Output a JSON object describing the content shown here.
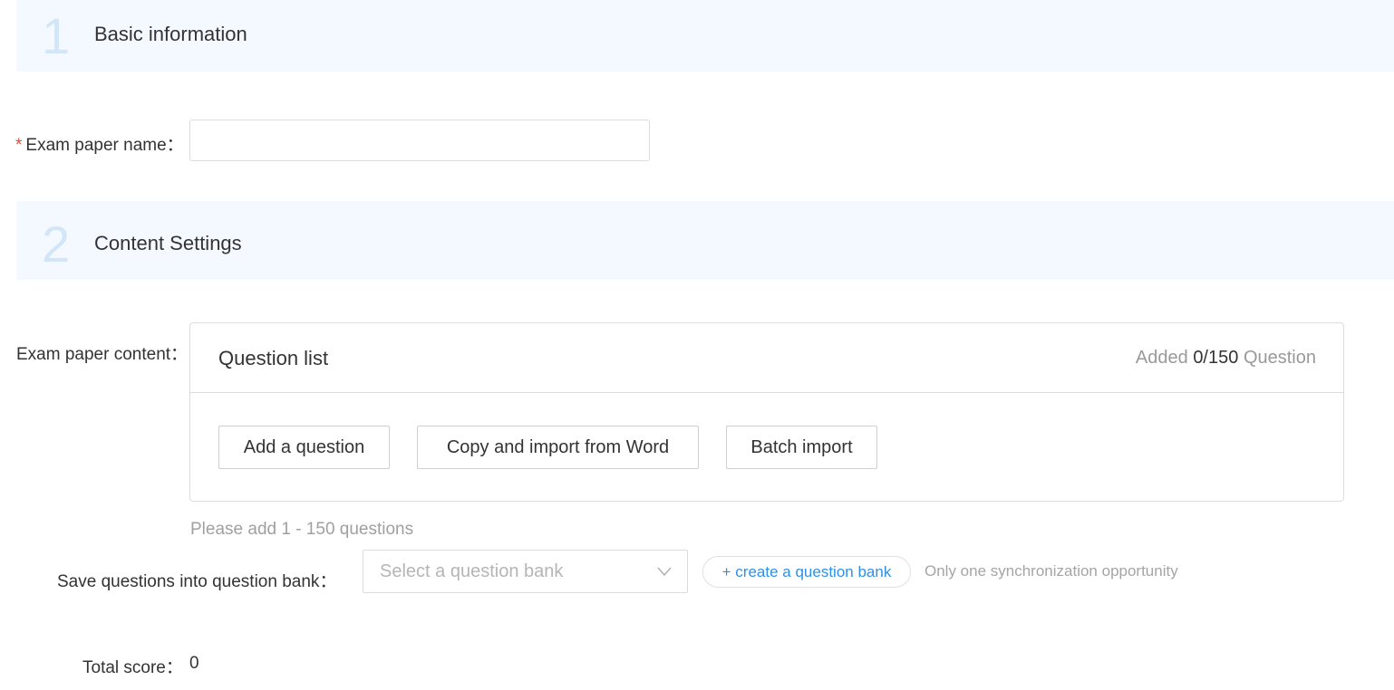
{
  "sections": [
    {
      "number": "1",
      "title": "Basic information"
    },
    {
      "number": "2",
      "title": "Content Settings"
    }
  ],
  "exam_name": {
    "required_mark": "*",
    "label": "Exam paper name",
    "colon": "：",
    "value": "",
    "placeholder": ""
  },
  "content": {
    "label": "Exam paper content",
    "colon": "：",
    "question_list": {
      "title": "Question list",
      "added_prefix": "Added",
      "added_count": "0/150",
      "added_suffix": "Question"
    },
    "buttons": {
      "add": "Add a question",
      "copy_import": "Copy and import from Word",
      "batch_import": "Batch import"
    },
    "hint": "Please add 1 - 150 questions"
  },
  "question_bank": {
    "label": "Save questions into question bank",
    "colon": "：",
    "select_placeholder": "Select a question bank",
    "create_label": "+ create a question bank",
    "note": "Only one synchronization opportunity",
    "chevron_icon": "chevron-down-icon"
  },
  "total_score": {
    "label": "Total score",
    "colon": "：",
    "value": "0"
  },
  "colors": {
    "section_bg": "#f4f9ff",
    "section_number": "#d3e6f8",
    "link_blue": "#2f8fe6",
    "required_red": "#e0483a"
  }
}
